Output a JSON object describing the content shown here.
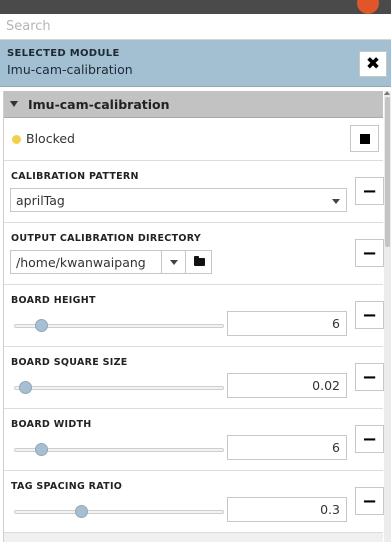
{
  "search": {
    "placeholder": "Search"
  },
  "selected_module": {
    "title": "SELECTED MODULE",
    "name": "Imu-cam-calibration",
    "close_icon": "close-x-icon"
  },
  "panel": {
    "title": "Imu-cam-calibration",
    "status": {
      "text": "Blocked",
      "color": "#f2d04a"
    },
    "parameters": {
      "calibration_pattern": {
        "label": "CALIBRATION PATTERN",
        "value": "aprilTag"
      },
      "output_dir": {
        "label": "OUTPUT CALIBRATION DIRECTORY",
        "value": "/home/kwanwaipang"
      },
      "board_height": {
        "label": "BOARD HEIGHT",
        "value": "6",
        "slider_fraction": 0.13
      },
      "board_square_size": {
        "label": "BOARD SQUARE SIZE",
        "value": "0.02",
        "slider_fraction": 0.05
      },
      "board_width": {
        "label": "BOARD WIDTH",
        "value": "6",
        "slider_fraction": 0.13
      },
      "tag_spacing_ratio": {
        "label": "TAG SPACING RATIO",
        "value": "0.3",
        "slider_fraction": 0.32
      }
    }
  },
  "colors": {
    "selected_bg": "#a3bfd2",
    "panel_header_bg": "#c2c2c2",
    "slider_thumb": "#a7bfd1"
  }
}
